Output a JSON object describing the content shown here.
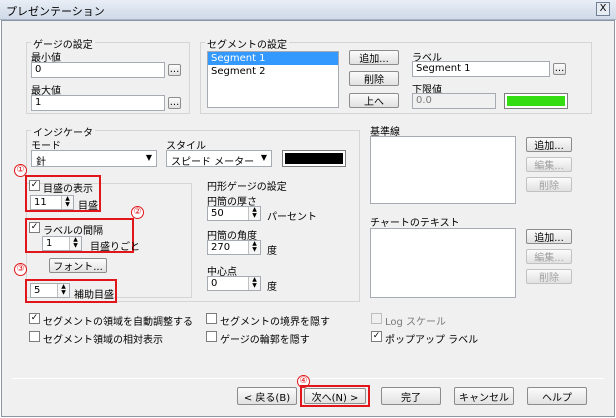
{
  "window": {
    "title": "プレゼンテーション",
    "close_glyph": "X"
  },
  "gauge": {
    "group_label": "ゲージの設定",
    "min_label": "最小値",
    "min_value": "0",
    "max_label": "最大値",
    "max_value": "1",
    "dots": "..."
  },
  "segment": {
    "group_label": "セグメントの設定",
    "items": [
      "Segment 1",
      "Segment 2"
    ],
    "add_label": "追加...",
    "delete_label": "削除",
    "up_label": "上へ",
    "label_caption": "ラベル",
    "label_value": "Segment 1",
    "lower_caption": "下限値",
    "lower_value": "0.0",
    "color": "#33dd11"
  },
  "indicator": {
    "group_label": "インジケータ",
    "mode_label": "モード",
    "mode_value": "針",
    "style_label": "スタイル",
    "style_value": "スピード メーター",
    "swatch_color": "#000000"
  },
  "ticks": {
    "show_label": "目盛の表示",
    "tick_value": "11",
    "tick_unit": "目盛",
    "label_interval_label": "ラベルの間隔",
    "interval_value": "1",
    "interval_unit": "目盛りごと",
    "font_button": "フォント...",
    "minor_value": "5",
    "minor_unit": "補助目盛"
  },
  "circle": {
    "group_label": "円形ゲージの設定",
    "thickness_label": "円筒の厚さ",
    "thickness_value": "50",
    "thickness_unit": "パーセント",
    "angle_label": "円筒の角度",
    "angle_value": "270",
    "angle_unit": "度",
    "center_label": "中心点",
    "center_value": "0",
    "center_unit": "度"
  },
  "baseline": {
    "group_label": "基準線",
    "add_label": "追加...",
    "edit_label": "編集...",
    "delete_label": "削除"
  },
  "charttext": {
    "group_label": "チャートのテキスト",
    "add_label": "追加...",
    "edit_label": "編集...",
    "delete_label": "削除"
  },
  "options": {
    "auto_adjust": "セグメントの領域を自動調整する",
    "relative": "セグメント領域の相対表示",
    "hide_border": "セグメントの境界を隠す",
    "hide_outline": "ゲージの輪郭を隠す",
    "log_scale": "Log スケール",
    "popup_label": "ポップアップ ラベル"
  },
  "markers": {
    "m1": "①",
    "m2": "②",
    "m3": "③",
    "m4": "④"
  },
  "footer": {
    "back": "< 戻る(B)",
    "next": "次へ(N) >",
    "finish": "完了",
    "cancel": "キャンセル",
    "help": "ヘルプ"
  },
  "check": "✓"
}
